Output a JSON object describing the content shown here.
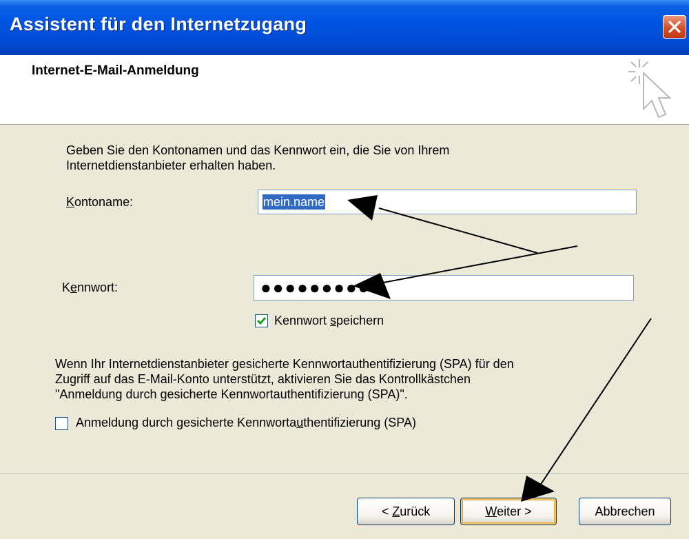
{
  "window": {
    "title": "Assistent für den Internetzugang"
  },
  "header": {
    "title": "Internet-E-Mail-Anmeldung"
  },
  "form": {
    "intro_line1": "Geben Sie den Kontonamen und das Kennwort ein, die Sie von Ihrem",
    "intro_line2": "Internetdienstanbieter erhalten haben.",
    "account_label_hotkey": "K",
    "account_label_rest": "ontoname:",
    "account_value": "mein.name",
    "password_label_pre": "K",
    "password_label_hotkey": "e",
    "password_label_rest": "nnwort:",
    "password_masked": "●●●●●●●●●",
    "remember_checked": true,
    "remember_pre": "Kennwort ",
    "remember_hotkey": "s",
    "remember_rest": "peichern",
    "spa_line1": "Wenn Ihr Internetdienstanbieter gesicherte Kennwortauthentifizierung (SPA) für den",
    "spa_line2": "Zugriff auf das E-Mail-Konto unterstützt, aktivieren Sie das Kontrollkästchen",
    "spa_line3": "\"Anmeldung durch gesicherte Kennwortauthentifizierung (SPA)\".",
    "spa_checked": false,
    "spa_checkbox_pre": "Anmeldung durch gesicherte Kennworta",
    "spa_checkbox_hotkey": "u",
    "spa_checkbox_rest": "thentifizierung (SPA)"
  },
  "buttons": {
    "back_pre": "< ",
    "back_hotkey": "Z",
    "back_rest": "urück",
    "next_hotkey": "W",
    "next_rest": "eiter >",
    "cancel": "Abbrechen"
  },
  "colors": {
    "titlebar": "#0053E1",
    "dialog_bg": "#ECE9D8",
    "selection": "#316AC5",
    "check": "#21A121",
    "annotation_arrows": "#000000"
  },
  "icons": {
    "close": "close-icon",
    "wizard": "wizard-cursor-icon",
    "check": "checkmark-icon"
  }
}
